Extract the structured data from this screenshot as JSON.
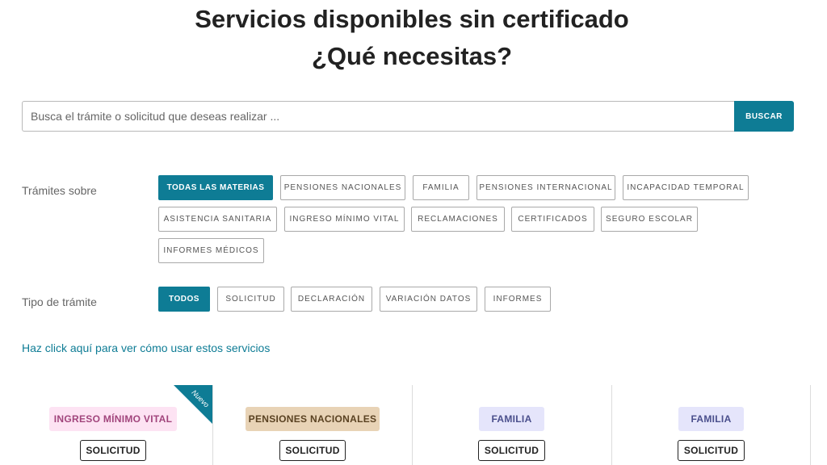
{
  "header": {
    "title_line1": "Servicios disponibles sin certificado",
    "title_line2": "¿Qué necesitas?"
  },
  "search": {
    "placeholder": "Busca el trámite o solicitud que deseas realizar ...",
    "value": "",
    "button_label": "BUSCAR"
  },
  "subjects": {
    "label": "Trámites sobre",
    "chips": [
      {
        "label": "TODAS LAS MATERIAS",
        "active": true
      },
      {
        "label": "PENSIONES NACIONALES",
        "active": false
      },
      {
        "label": "FAMILIA",
        "active": false
      },
      {
        "label": "PENSIONES INTERNACIONAL",
        "active": false
      },
      {
        "label": "INCAPACIDAD TEMPORAL",
        "active": false
      },
      {
        "label": "ASISTENCIA SANITARIA",
        "active": false
      },
      {
        "label": "INGRESO MÍNIMO VITAL",
        "active": false
      },
      {
        "label": "RECLAMACIONES",
        "active": false
      },
      {
        "label": "CERTIFICADOS",
        "active": false
      },
      {
        "label": "SEGURO ESCOLAR",
        "active": false
      },
      {
        "label": "INFORMES MÉDICOS",
        "active": false
      }
    ]
  },
  "types": {
    "label": "Tipo de trámite",
    "chips": [
      {
        "label": "TODOS",
        "active": true
      },
      {
        "label": "SOLICITUD",
        "active": false
      },
      {
        "label": "DECLARACIÓN",
        "active": false
      },
      {
        "label": "VARIACIÓN DATOS",
        "active": false
      },
      {
        "label": "INFORMES",
        "active": false
      }
    ]
  },
  "help_link": "Haz click aquí para ver cómo usar estos servicios",
  "colors": {
    "accent": "#0e7c95",
    "tag_pink_bg": "#fde3f3",
    "tag_tan_bg": "#e8d3b6",
    "tag_lavender_bg": "#e5e5fb"
  },
  "cards": [
    {
      "tag": "INGRESO MÍNIMO VITAL",
      "kind": "SOLICITUD",
      "ribbon": "Nuevo"
    },
    {
      "tag": "PENSIONES NACIONALES",
      "kind": "SOLICITUD"
    },
    {
      "tag": "FAMILIA",
      "kind": "SOLICITUD"
    },
    {
      "tag": "FAMILIA",
      "kind": "SOLICITUD"
    }
  ]
}
